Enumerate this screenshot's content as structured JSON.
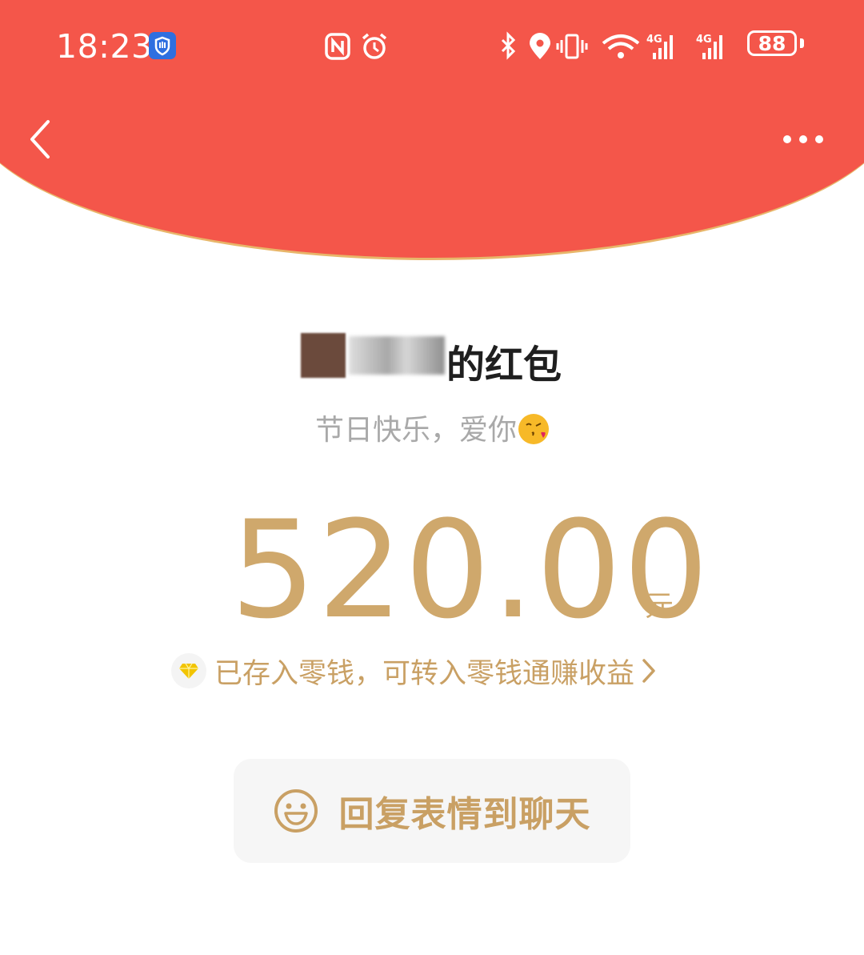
{
  "status_bar": {
    "time": "18:23",
    "battery": "88",
    "icons": [
      "app-shield-icon",
      "nfc-icon",
      "alarm-icon",
      "bluetooth-icon",
      "location-icon",
      "vibrate-icon",
      "wifi-icon",
      "signal-4g-icon",
      "signal-4g-icon",
      "battery-icon"
    ]
  },
  "header": {
    "back_icon": "chevron-left-icon",
    "more_icon": "more-dots-icon",
    "color": "#f4564a"
  },
  "red_packet": {
    "sender_suffix": "的红包",
    "greeting": "节日快乐，爱你",
    "greeting_emoji": "kiss-emoji",
    "amount": "520.00",
    "unit": "元",
    "notice": "已存入零钱，可转入零钱通赚收益",
    "notice_icon": "diamond-icon",
    "accent_color": "#cfa86c"
  },
  "reply_button": {
    "label": "回复表情到聊天",
    "icon": "smile-icon"
  }
}
